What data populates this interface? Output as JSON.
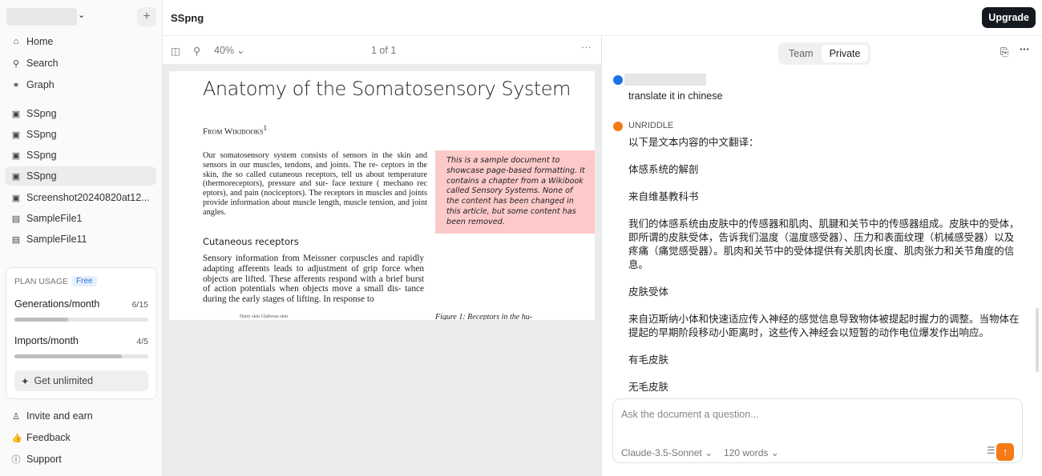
{
  "sidebar": {
    "nav": [
      {
        "label": "Home",
        "icon": "home-icon"
      },
      {
        "label": "Search",
        "icon": "search-icon"
      },
      {
        "label": "Graph",
        "icon": "graph-icon"
      }
    ],
    "files": [
      {
        "label": "SSpng",
        "icon": "image-file-icon"
      },
      {
        "label": "SSpng",
        "icon": "image-file-icon"
      },
      {
        "label": "SSpng",
        "icon": "image-file-icon"
      },
      {
        "label": "SSpng",
        "icon": "image-file-icon",
        "active": true
      },
      {
        "label": "Screenshot20240820at12...",
        "icon": "image-file-icon"
      },
      {
        "label": "SampleFile1",
        "icon": "doc-file-icon"
      },
      {
        "label": "SampleFile11",
        "icon": "doc-file-icon"
      }
    ],
    "plan": {
      "title": "PLAN USAGE",
      "badge": "Free",
      "generations_label": "Generations/month",
      "generations_value": "6/15",
      "generations_fraction": 0.4,
      "imports_label": "Imports/month",
      "imports_value": "4/5",
      "imports_fraction": 0.8,
      "get_unlimited": "Get unlimited"
    },
    "bottom": [
      {
        "label": "Invite and earn"
      },
      {
        "label": "Feedback"
      },
      {
        "label": "Support"
      }
    ]
  },
  "header": {
    "title": "SSpng",
    "upgrade": "Upgrade"
  },
  "doc_toolbar": {
    "zoom": "40%",
    "page": "1 of 1"
  },
  "document": {
    "title": "Anatomy of the Somatosensory System",
    "from": "From Wikibooks",
    "from_sup": "1",
    "para1": "Our somatosensory system consists of sensors in the skin and sensors in our muscles, tendons, and joints. The re- ceptors in the skin, the so called cutaneous receptors, tell us about temperature (thermoreceptors), pressure and sur- face texture ( mechano rec eptors), and pain (nociceptors). The receptors in muscles and joints provide information about muscle length, muscle tension, and joint angles.",
    "note": "This is a sample document to showcase page-based formatting. It contains a chapter from a Wikibook called Sensory Systems. None of the content has been changed in this article, but some content has been removed.",
    "heading2": "Cutaneous receptors",
    "para2": "Sensory information from Meissner corpuscles and rapidly adapting afferents leads to adjustment of grip force when objects are lifted. These afferents respond with a brief burst of action potentials when objects move a small dis- tance during the early stages of lifting. In response to",
    "figure_labels": "Hairy skin          Glabrous skin",
    "caption": "Figure 1:  Receptors in the hu-"
  },
  "chat": {
    "tabs": [
      "Team",
      "Private"
    ],
    "active_tab": "Private",
    "user_message": "translate it in chinese",
    "assistant_name": "UNRIDDLE",
    "assistant_message": "以下是文本内容的中文翻译：\n\n体感系统的解剖\n\n来自维基教科书\n\n我们的体感系统由皮肤中的传感器和肌肉、肌腱和关节中的传感器组成。皮肤中的受体，即所谓的皮肤受体，告诉我们温度（温度感受器）、压力和表面纹理（机械感受器）以及疼痛（痛觉感受器）。肌肉和关节中的受体提供有关肌肉长度、肌肉张力和关节角度的信息。\n\n皮肤受体\n\n来自迈斯纳小体和快速适应传入神经的感觉信息导致物体被提起时握力的调整。当物体在提起的早期阶段移动小距离时，这些传入神经会以短暂的动作电位爆发作出响应。\n\n有毛皮肤\n\n无毛皮肤",
    "placeholder": "Ask the document a question...",
    "model": "Claude-3.5-Sonnet",
    "length": "120 words"
  },
  "colors": {
    "accent": "#f47b16",
    "user_dot": "#1a73e8",
    "note_bg": "#fdcaca",
    "upgrade_bg": "#14181f"
  }
}
